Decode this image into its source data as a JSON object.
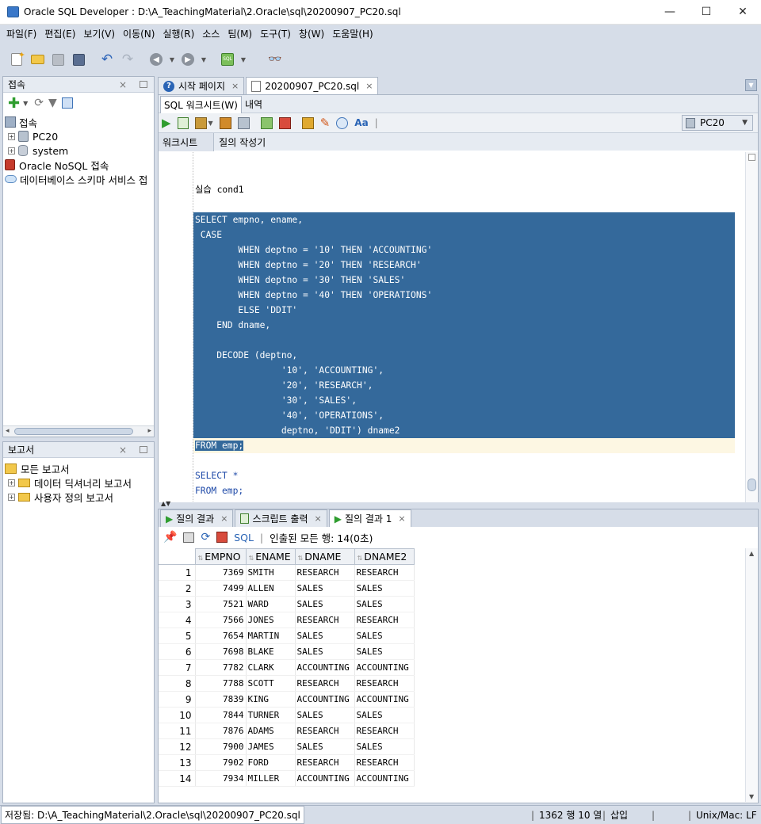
{
  "window": {
    "title": "Oracle SQL Developer : D:\\A_TeachingMaterial\\2.Oracle\\sql\\20200907_PC20.sql",
    "min": "—",
    "max": "☐",
    "close": "✕"
  },
  "menu": [
    "파일(F)",
    "편집(E)",
    "보기(V)",
    "이동(N)",
    "실행(R)",
    "소스",
    "팀(M)",
    "도구(T)",
    "창(W)",
    "도움말(H)"
  ],
  "connections_panel": {
    "title": "접속",
    "close": "×",
    "tree": [
      {
        "label": "접속",
        "level": 0,
        "icon": "connections-icon"
      },
      {
        "label": "PC20",
        "level": 1,
        "icon": "database-connection-icon"
      },
      {
        "label": "system",
        "level": 1,
        "icon": "database-icon"
      },
      {
        "label": "Oracle NoSQL 접속",
        "level": 0,
        "icon": "nosql-icon"
      },
      {
        "label": "데이터베이스 스키마 서비스 접",
        "level": 0,
        "icon": "cloud-icon"
      }
    ]
  },
  "reports_panel": {
    "title": "보고서",
    "close": "×",
    "tree": [
      {
        "label": "모든 보고서",
        "level": 0
      },
      {
        "label": "데이터 딕셔너리 보고서",
        "level": 1
      },
      {
        "label": "사용자 정의 보고서",
        "level": 1
      }
    ]
  },
  "editor_tabs": [
    {
      "label": "시작 페이지",
      "active": false
    },
    {
      "label": "20200907_PC20.sql",
      "active": true
    }
  ],
  "editor_subtabs": {
    "worksheet": "SQL 워크시트(W)",
    "history": "내역"
  },
  "connection_selector": "PC20",
  "worksheet_tabs": [
    "워크시트",
    "질의 작성기"
  ],
  "code_lines": [
    {
      "text": "",
      "sel": false
    },
    {
      "text": "",
      "sel": false
    },
    {
      "text": "실습 cond1",
      "sel": false
    },
    {
      "text": "",
      "sel": false
    },
    {
      "text": "SELECT empno, ename,",
      "sel": true
    },
    {
      "text": " CASE",
      "sel": true
    },
    {
      "text": "        WHEN deptno = '10' THEN 'ACCOUNTING'",
      "sel": true
    },
    {
      "text": "        WHEN deptno = '20' THEN 'RESEARCH'",
      "sel": true
    },
    {
      "text": "        WHEN deptno = '30' THEN 'SALES'",
      "sel": true
    },
    {
      "text": "        WHEN deptno = '40' THEN 'OPERATIONS'",
      "sel": true
    },
    {
      "text": "        ELSE 'DDIT'",
      "sel": true
    },
    {
      "text": "    END dname,",
      "sel": true
    },
    {
      "text": "",
      "sel": true
    },
    {
      "text": "    DECODE (deptno,",
      "sel": true
    },
    {
      "text": "                '10', 'ACCOUNTING',",
      "sel": true
    },
    {
      "text": "                '20', 'RESEARCH',",
      "sel": true
    },
    {
      "text": "                '30', 'SALES',",
      "sel": true
    },
    {
      "text": "                '40', 'OPERATIONS',",
      "sel": true
    },
    {
      "text": "                deptno, 'DDIT') dname2",
      "sel": true
    },
    {
      "text": "FROM emp;",
      "sel": "partial"
    },
    {
      "text": "",
      "sel": false
    },
    {
      "text": "SELECT *",
      "sel": false
    },
    {
      "text": "FROM emp;",
      "sel": false
    }
  ],
  "result_tabs": [
    {
      "label": "질의 결과",
      "close": "×"
    },
    {
      "label": "스크립트 출력",
      "close": "×"
    },
    {
      "label": "질의 결과 1",
      "close": "×",
      "active": true
    }
  ],
  "result_toolbar": {
    "sql_label": "SQL",
    "fetch_status": "인출된 모든 행: 14(0초)"
  },
  "grid": {
    "columns": [
      "EMPNO",
      "ENAME",
      "DNAME",
      "DNAME2"
    ],
    "rows": [
      [
        "1",
        "7369",
        "SMITH",
        "RESEARCH",
        "RESEARCH"
      ],
      [
        "2",
        "7499",
        "ALLEN",
        "SALES",
        "SALES"
      ],
      [
        "3",
        "7521",
        "WARD",
        "SALES",
        "SALES"
      ],
      [
        "4",
        "7566",
        "JONES",
        "RESEARCH",
        "RESEARCH"
      ],
      [
        "5",
        "7654",
        "MARTIN",
        "SALES",
        "SALES"
      ],
      [
        "6",
        "7698",
        "BLAKE",
        "SALES",
        "SALES"
      ],
      [
        "7",
        "7782",
        "CLARK",
        "ACCOUNTING",
        "ACCOUNTING"
      ],
      [
        "8",
        "7788",
        "SCOTT",
        "RESEARCH",
        "RESEARCH"
      ],
      [
        "9",
        "7839",
        "KING",
        "ACCOUNTING",
        "ACCOUNTING"
      ],
      [
        "10",
        "7844",
        "TURNER",
        "SALES",
        "SALES"
      ],
      [
        "11",
        "7876",
        "ADAMS",
        "RESEARCH",
        "RESEARCH"
      ],
      [
        "12",
        "7900",
        "JAMES",
        "SALES",
        "SALES"
      ],
      [
        "13",
        "7902",
        "FORD",
        "RESEARCH",
        "RESEARCH"
      ],
      [
        "14",
        "7934",
        "MILLER",
        "ACCOUNTING",
        "ACCOUNTING"
      ]
    ]
  },
  "status": {
    "saved": "저장됨: D:\\A_TeachingMaterial\\2.Oracle\\sql\\20200907_PC20.sql",
    "position": "1362 행 10 열",
    "mode": "삽입",
    "line_ending": "Unix/Mac: LF"
  },
  "colors": {
    "selection": "#34699b",
    "current_line": "#fdf7e3",
    "chrome": "#d6dde8",
    "keyword": "#1f4aa8"
  }
}
